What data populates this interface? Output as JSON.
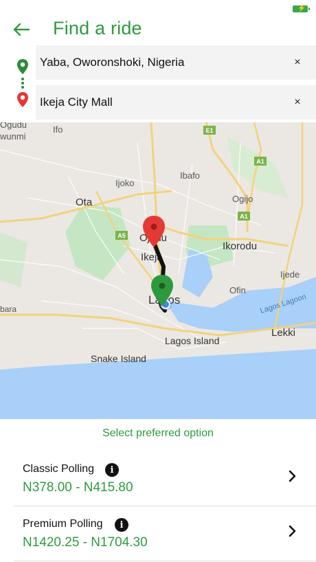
{
  "status": {
    "battery_color": "#39a845"
  },
  "header": {
    "title": "Find a ride",
    "back_icon": "arrow-left-icon"
  },
  "pickup": {
    "value": "Yaba, Oworonshoki, Nigeria",
    "pin_color": "#2e8b3a",
    "clear": "×"
  },
  "dropoff": {
    "value": "Ikeja City Mall",
    "pin_color": "#e53935",
    "clear": "×"
  },
  "map": {
    "labels": {
      "ogudu": "Ogudu",
      "wunmi": "wunmi",
      "ifo": "Ifo",
      "ijoko": "Ijoko",
      "ibafo": "Ibafo",
      "ota": "Ota",
      "ogijo": "Ogijo",
      "ojodu": "Ojodu",
      "ikeja": "Ikeja",
      "ikorodu": "Ikorodu",
      "ijede": "Ijede",
      "ofin": "Ofin",
      "lagos": "Lagos",
      "lagos_lagoon": "Lagos Lagoon",
      "bara": "bara",
      "lagos_island": "Lagos Island",
      "lekki": "Lekki",
      "snake_island": "Snake Island"
    },
    "road_badges": {
      "e1": "E1",
      "a1_top": "A1",
      "a1_mid": "A1",
      "a5": "A5"
    },
    "colors": {
      "land": "#ebe8e3",
      "water": "#a8d0f8",
      "park": "#c5e6c3",
      "road": "#f3d27c",
      "route": "#111111",
      "dest_pin": "#e53935",
      "origin_pin": "#2e9a3e",
      "location_dot": "#4285f4"
    }
  },
  "options": {
    "heading": "Select preferred option",
    "items": [
      {
        "name": "Classic Polling",
        "price": "N378.00 - N415.80"
      },
      {
        "name": "Premium Polling",
        "price": "N1420.25 - N1704.30"
      }
    ]
  },
  "accent": "#2e9a3e"
}
